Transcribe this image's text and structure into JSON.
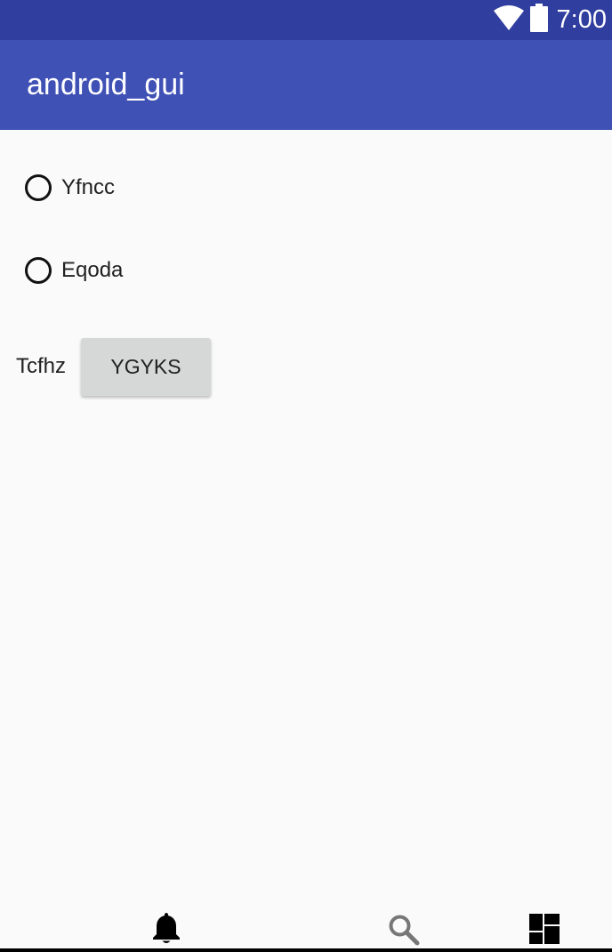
{
  "status_bar": {
    "time": "7:00",
    "icons": [
      "wifi-icon",
      "battery-icon"
    ],
    "background": "#303f9f"
  },
  "app_bar": {
    "title": "android_gui",
    "background": "#3f51b5"
  },
  "radio_options": [
    {
      "label": "Yfncc",
      "checked": false
    },
    {
      "label": "Eqoda",
      "checked": false
    }
  ],
  "action_row": {
    "label": "Tcfhz",
    "button_label": "YGYKS"
  },
  "bottom_nav": {
    "icons": [
      "bell-icon",
      "search-icon",
      "dashboard-icon"
    ]
  }
}
